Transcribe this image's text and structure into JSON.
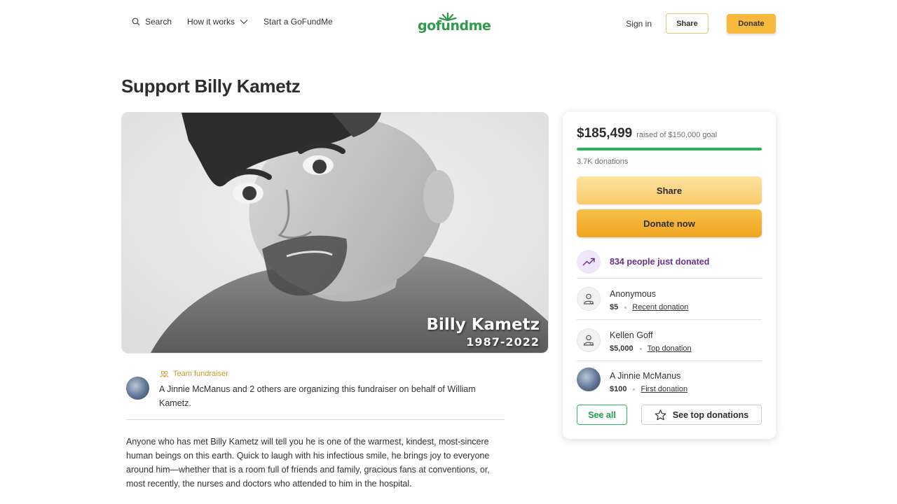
{
  "header": {
    "search_label": "Search",
    "how_it_works_label": "How it works",
    "start_label": "Start a GoFundMe",
    "logo_text": "gofundme",
    "signin_label": "Sign in",
    "share_label": "Share",
    "donate_label": "Donate"
  },
  "page": {
    "title": "Support Billy Kametz"
  },
  "hero": {
    "overlay_name": "Billy Kametz",
    "overlay_years": "1987-2022"
  },
  "organizer": {
    "team_tag": "Team fundraiser",
    "text": "A Jinnie McManus and 2 others are organizing this fundraiser on behalf of William Kametz."
  },
  "story": {
    "text": "Anyone who has met Billy Kametz will tell you he is one of the warmest, kindest, most-sincere human beings on this earth. Quick to laugh with his infectious smile, he brings joy to everyone around him—whether that is a room full of friends and family, gracious fans at conventions, or, most recently, the nurses and doctors who attended to him in the hospital."
  },
  "card": {
    "raised": "$185,499",
    "goal_text": "raised of $150,000 goal",
    "progress_fraction": 1.0,
    "donations_count": "3.7K donations",
    "share_label": "Share",
    "donate_now_label": "Donate now",
    "recent_text": "834 people just donated",
    "donors": [
      {
        "name": "Anonymous",
        "amount": "$5",
        "tag": "Recent donation"
      },
      {
        "name": "Kellen Goff",
        "amount": "$5,000",
        "tag": "Top donation"
      },
      {
        "name": "A Jinnie McManus",
        "amount": "$100",
        "tag": "First donation"
      }
    ],
    "see_all_label": "See all",
    "see_top_label": "See top donations"
  },
  "colors": {
    "brand_green": "#2f9a4a",
    "donate_yellow": "#f6b93c",
    "progress_green": "#28b45a",
    "recent_purple": "#6b2f8f"
  },
  "icons": [
    "search-icon",
    "chevron-down-icon",
    "logo-sprout-icon",
    "trending-up-icon",
    "team-icon",
    "donor-person-icon",
    "star-icon"
  ]
}
